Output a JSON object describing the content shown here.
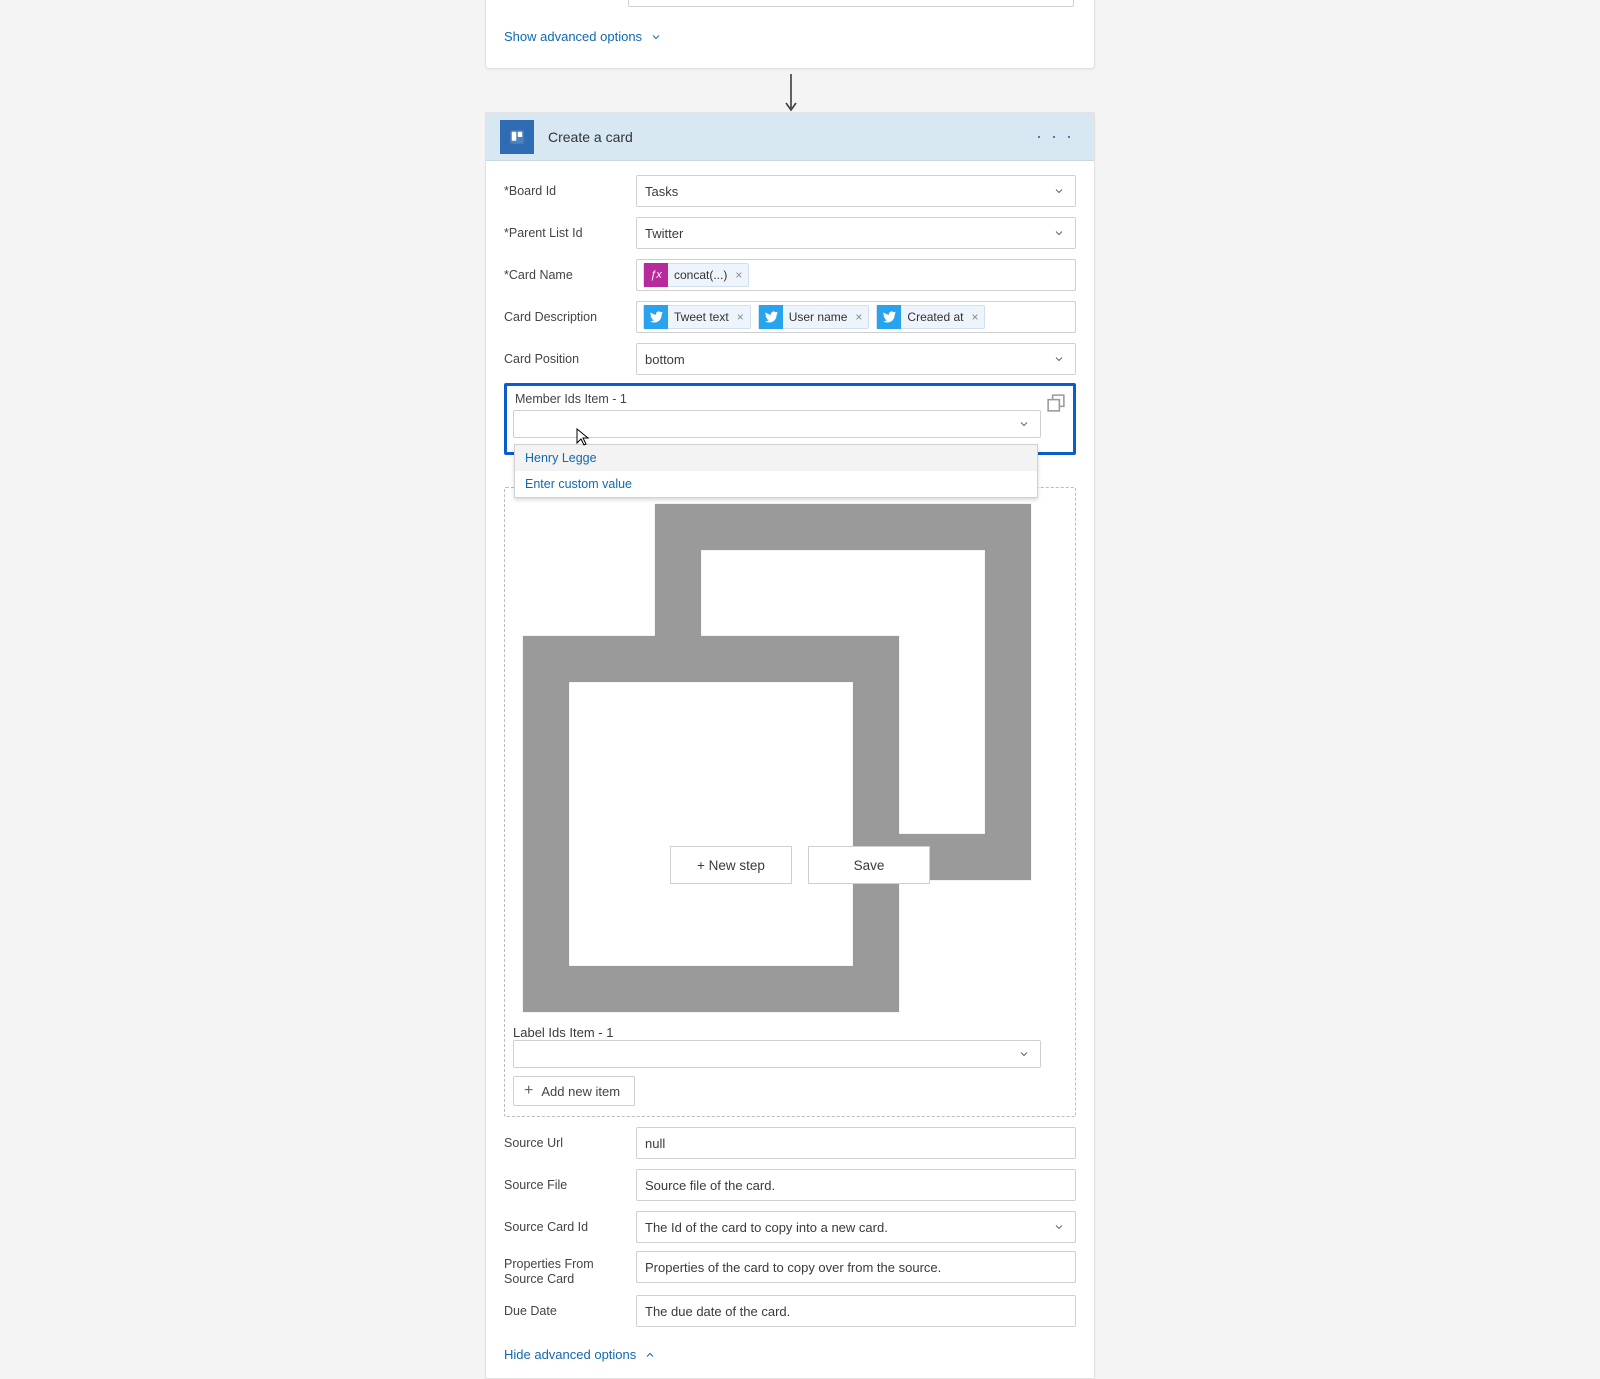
{
  "top": {
    "advanced_label": "Show advanced options"
  },
  "action": {
    "title": "Create a card",
    "fields": {
      "board": {
        "label": "Board Id",
        "required": true,
        "value": "Tasks"
      },
      "parentList": {
        "label": "Parent List Id",
        "required": true,
        "value": "Twitter"
      },
      "cardName": {
        "label": "Card Name",
        "required": true
      },
      "cardDesc": {
        "label": "Card Description"
      },
      "cardPos": {
        "label": "Card Position",
        "value": "bottom"
      },
      "memberIds": {
        "label": "Member Ids Item - 1",
        "options": [
          "Henry Legge"
        ],
        "custom": "Enter custom value"
      },
      "labelIds": {
        "label": "Label Ids Item - 1"
      },
      "addItem": "Add new item",
      "sourceUrl": {
        "label": "Source Url",
        "value": "null"
      },
      "sourceFile": {
        "label": "Source File",
        "placeholder": "Source file of the card."
      },
      "sourceCard": {
        "label": "Source Card Id",
        "placeholder": "The Id of the card to copy into a new card."
      },
      "props": {
        "label": "Properties From Source Card",
        "placeholder": "Properties of the card to copy over from the source."
      },
      "dueDate": {
        "label": "Due Date",
        "placeholder": "The due date of the card."
      }
    },
    "pills": {
      "fx": "concat(...)",
      "tweetText": "Tweet text",
      "userName": "User name",
      "createdAt": "Created at"
    },
    "hideAdvanced": "Hide advanced options"
  },
  "footer": {
    "newStep": "+ New step",
    "save": "Save"
  }
}
